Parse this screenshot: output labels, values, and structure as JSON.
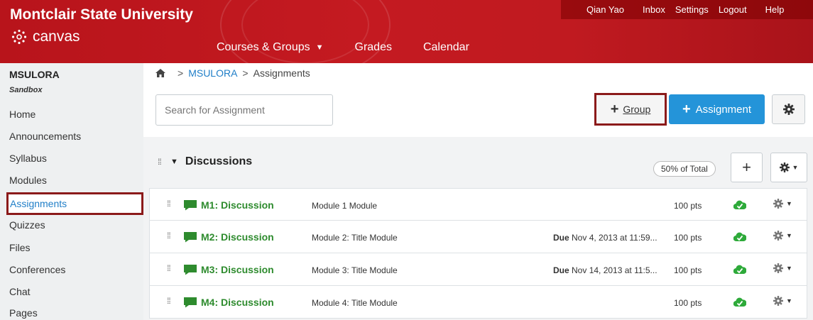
{
  "header": {
    "university": "Montclair State University",
    "logo_text": "canvas",
    "nav": [
      {
        "label": "Courses & Groups",
        "has_caret": true
      },
      {
        "label": "Grades"
      },
      {
        "label": "Calendar"
      }
    ],
    "user_links": [
      "Qian Yao",
      "Inbox",
      "Settings",
      "Logout",
      "Help"
    ]
  },
  "sidebar": {
    "course": "MSULORA",
    "subtitle": "Sandbox",
    "items": [
      {
        "label": "Home"
      },
      {
        "label": "Announcements"
      },
      {
        "label": "Syllabus"
      },
      {
        "label": "Modules"
      },
      {
        "label": "Assignments",
        "active": true
      },
      {
        "label": "Quizzes"
      },
      {
        "label": "Files"
      },
      {
        "label": "Conferences"
      },
      {
        "label": "Chat"
      },
      {
        "label": "Pages"
      }
    ]
  },
  "breadcrumb": {
    "course": "MSULORA",
    "current": "Assignments"
  },
  "toolbar": {
    "search_placeholder": "Search for Assignment",
    "group_label": "Group",
    "assignment_label": "Assignment"
  },
  "group": {
    "title": "Discussions",
    "weight": "50% of Total",
    "assignments": [
      {
        "name": "M1: Discussion",
        "module": "Module 1 Module",
        "due_label": "",
        "due": "",
        "points": "100 pts"
      },
      {
        "name": "M2: Discussion",
        "module": "Module 2: Title Module",
        "due_label": "Due",
        "due": "Nov 4, 2013 at 11:59...",
        "points": "100 pts"
      },
      {
        "name": "M3: Discussion",
        "module": "Module 3: Title Module",
        "due_label": "Due",
        "due": "Nov 14, 2013 at 11:5...",
        "points": "100 pts"
      },
      {
        "name": "M4: Discussion",
        "module": "Module 4: Title Module",
        "due_label": "",
        "due": "",
        "points": "100 pts"
      }
    ]
  },
  "colors": {
    "header_red": "#c41a21",
    "link_blue": "#1f7ec7",
    "primary_button": "#2494d9",
    "discussion_green": "#2e8b2e",
    "highlight_border": "#8b1a1a"
  }
}
